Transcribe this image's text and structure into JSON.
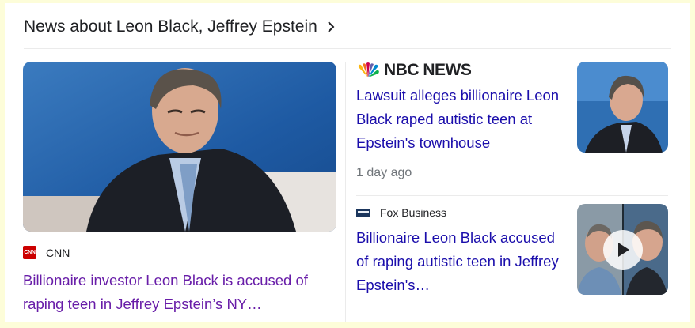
{
  "header": {
    "title": "News about Leon Black, Jeffrey Epstein"
  },
  "stories": [
    {
      "source": "CNN",
      "logo_text": "CNN",
      "title": "Billionaire investor Leon Black is accused of raping teen in Jeffrey Epstein’s NY…",
      "image": "photo of Leon Black seated on stage"
    },
    {
      "source": "NBC NEWS",
      "title": "Lawsuit alleges billionaire Leon Black raped autistic teen at Epstein's townhouse",
      "time": "1 day ago",
      "image": "photo of Leon Black"
    },
    {
      "source": "Fox Business",
      "title": "Billionaire Leon Black accused of raping autistic teen in Jeffrey Epstein's…",
      "image": "video thumbnail of Jeffrey Epstein and Leon Black",
      "has_video": true
    }
  ],
  "colors": {
    "visited_link": "#681da8",
    "link": "#1a0dab",
    "meta_text": "#70757a",
    "page_background": "#fdfdd9"
  }
}
